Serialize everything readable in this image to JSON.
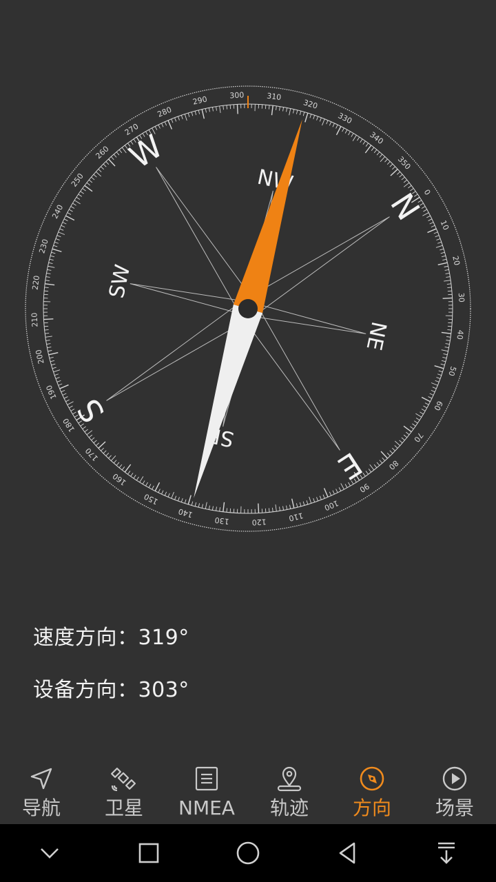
{
  "compass": {
    "cardinals": [
      "N",
      "E",
      "S",
      "W"
    ],
    "intercardinals": [
      "NE",
      "SE",
      "SW",
      "NW"
    ],
    "rotation_deg": 303,
    "needle_heading_deg": 319,
    "colors": {
      "needle_north": "#ef8214",
      "needle_south": "#efefef",
      "dial": "#d8d8d8",
      "marker": "#ef8214"
    }
  },
  "readouts": {
    "speed_direction": "速度方向：319°",
    "device_direction": "设备方向：303°"
  },
  "nav": {
    "items": [
      {
        "id": "navigation",
        "label": "导航",
        "icon": "navigation-arrow-icon"
      },
      {
        "id": "satellite",
        "label": "卫星",
        "icon": "satellite-icon"
      },
      {
        "id": "nmea",
        "label": "NMEA",
        "icon": "document-list-icon"
      },
      {
        "id": "track",
        "label": "轨迹",
        "icon": "map-pin-icon"
      },
      {
        "id": "direction",
        "label": "方向",
        "icon": "compass-icon",
        "active": true
      },
      {
        "id": "scene",
        "label": "场景",
        "icon": "play-circle-icon"
      }
    ]
  }
}
